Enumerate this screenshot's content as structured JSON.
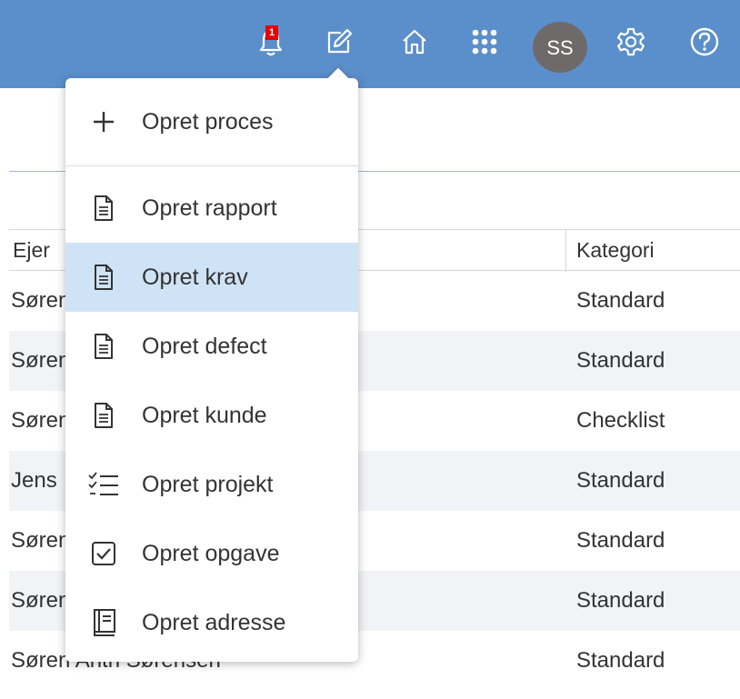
{
  "topbar": {
    "notification_count": "1",
    "avatar_initials": "SS",
    "accent_color": "#5b8fcb",
    "icons": [
      "bell-icon",
      "edit-icon",
      "home-icon",
      "apps-grid-icon",
      "gear-icon",
      "help-icon"
    ]
  },
  "table": {
    "columns": {
      "owner": "Ejer",
      "category": "Kategori"
    },
    "rows": [
      {
        "owner": "Søren Anth Sørensen",
        "category": "Standard"
      },
      {
        "owner": "Søren Anth Sørensen",
        "category": "Standard"
      },
      {
        "owner": "Søren Anth Sørensen",
        "category": "Checklist"
      },
      {
        "owner": "Jens",
        "category": "Standard"
      },
      {
        "owner": "Søren Anth Sørensen",
        "category": "Standard"
      },
      {
        "owner": "Søren Anth Sørensen",
        "category": "Standard"
      },
      {
        "owner": "Søren Anth Sørensen",
        "category": "Standard"
      }
    ]
  },
  "create_menu": {
    "items": [
      {
        "label": "Opret proces",
        "icon": "plus-icon"
      },
      {
        "label": "Opret rapport",
        "icon": "document-icon"
      },
      {
        "label": "Opret krav",
        "icon": "document-icon",
        "active": true
      },
      {
        "label": "Opret defect",
        "icon": "document-icon"
      },
      {
        "label": "Opret kunde",
        "icon": "document-icon"
      },
      {
        "label": "Opret projekt",
        "icon": "checklist-icon"
      },
      {
        "label": "Opret opgave",
        "icon": "checkbox-icon"
      },
      {
        "label": "Opret adresse",
        "icon": "address-book-icon"
      }
    ],
    "active_color": "#cfe3f6"
  }
}
